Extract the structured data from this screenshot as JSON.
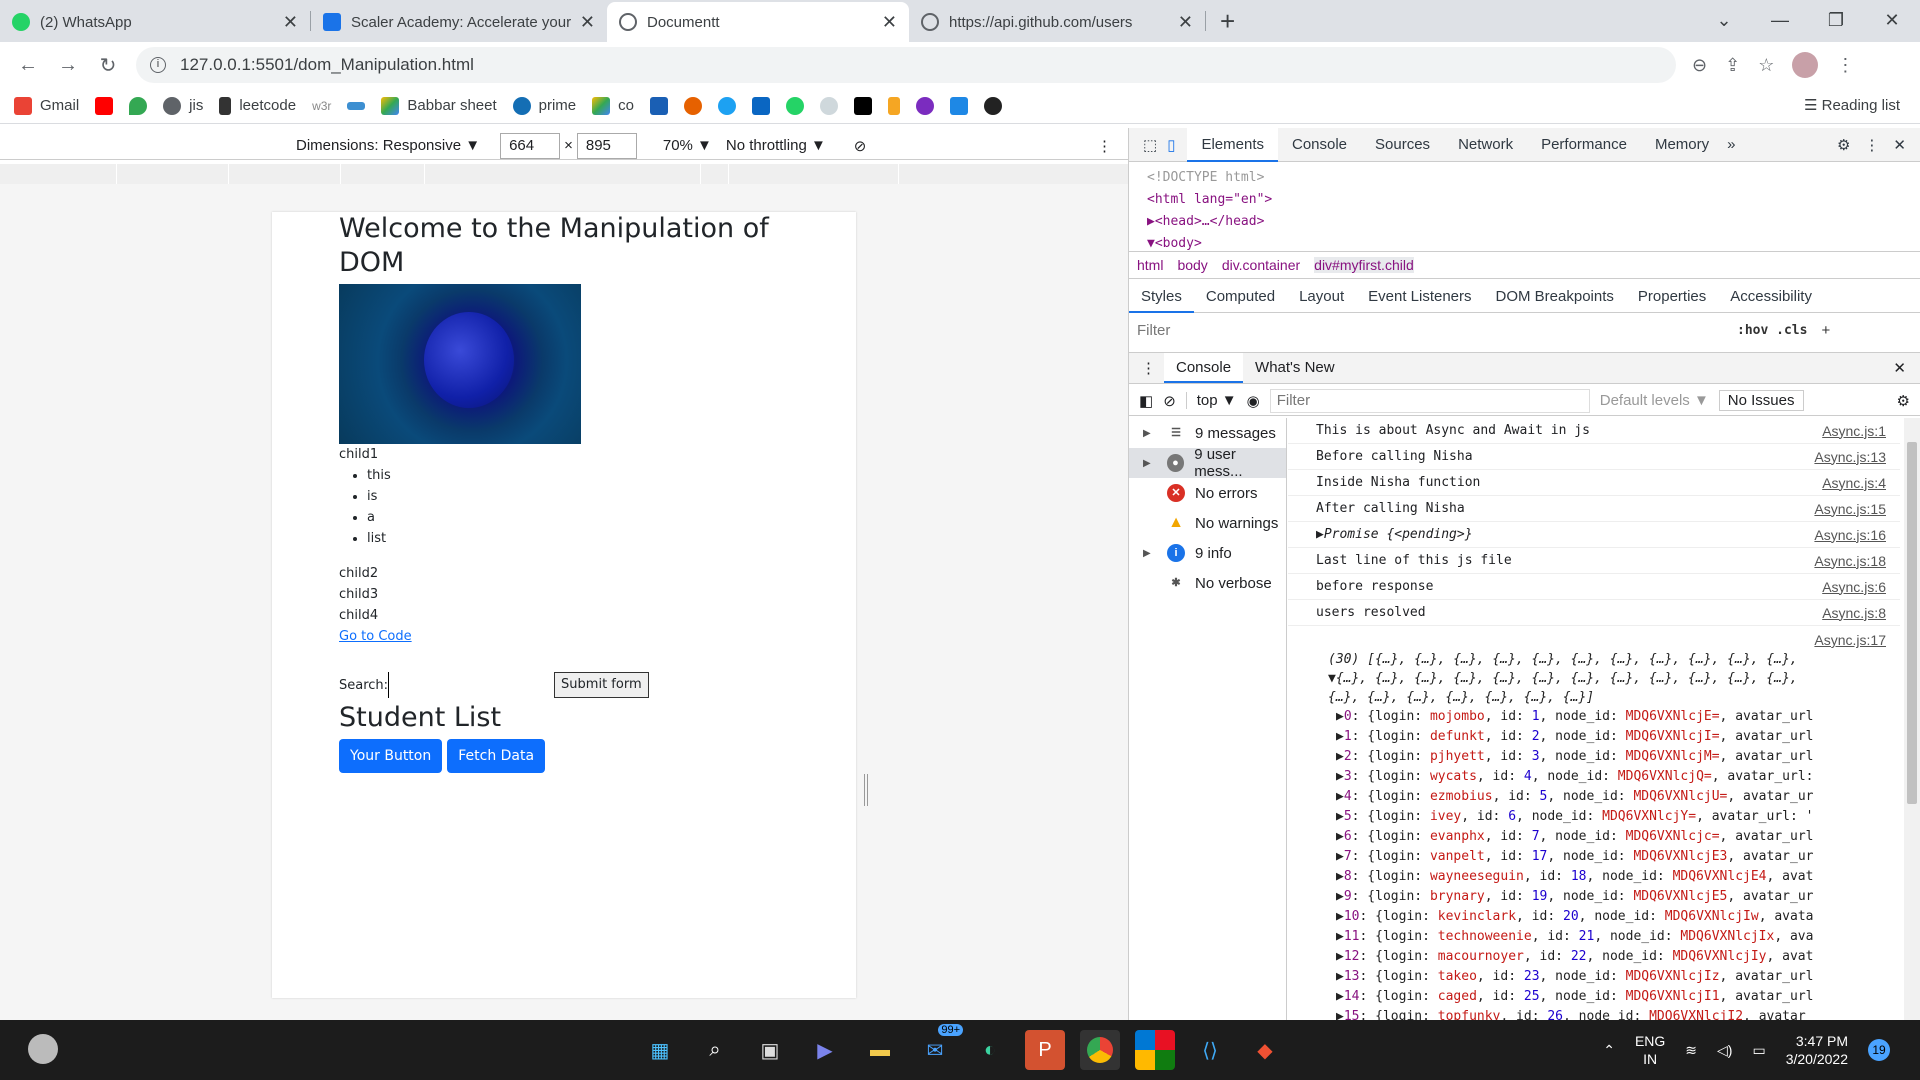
{
  "tabs": [
    {
      "title": "(2) WhatsApp",
      "color": "#25d366"
    },
    {
      "title": "Scaler Academy: Accelerate your",
      "color": "#1a73e8"
    },
    {
      "title": "Documentt",
      "color": "#5f6368"
    },
    {
      "title": "https://api.github.com/users",
      "color": "#5f6368"
    }
  ],
  "url": "127.0.0.1:5501/dom_Manipulation.html",
  "bookmarks": [
    "Gmail",
    "",
    "",
    "jis",
    "leetcode",
    "w3r",
    "",
    "Babbar sheet",
    "prime",
    "co"
  ],
  "reading_list": "Reading list",
  "device_toolbar": {
    "dimensions": "Dimensions: Responsive ▼",
    "width": "664",
    "times": "×",
    "height": "895",
    "zoom": "70% ▼",
    "throttle": "No throttling ▼"
  },
  "page": {
    "heading": "Welcome to the Manipulation of DOM",
    "child1": "child1",
    "list": [
      "this",
      "is",
      "a",
      "list"
    ],
    "child2": "child2",
    "child3": "child3",
    "child4": "child4",
    "link": "Go to Code",
    "search_label": "Search:",
    "submit": "Submit form",
    "student_list": "Student List",
    "btn1": "Your Button",
    "btn2": "Fetch Data"
  },
  "devtools": {
    "tabs": [
      "Elements",
      "Console",
      "Sources",
      "Network",
      "Performance",
      "Memory"
    ],
    "dom_lines": [
      "<!DOCTYPE html>",
      "<html lang=\"en\">",
      "▶<head>…</head>",
      "▼<body>"
    ],
    "crumbs": [
      "html",
      "body",
      "div.container",
      "div#myfirst.child"
    ],
    "subtabs": [
      "Styles",
      "Computed",
      "Layout",
      "Event Listeners",
      "DOM Breakpoints",
      "Properties",
      "Accessibility"
    ],
    "filter": "Filter",
    "hov": ":hov .cls",
    "drawer_tabs": [
      "Console",
      "What's New"
    ],
    "context": "top ▼",
    "cfilter": "Filter",
    "levels": "Default levels ▼",
    "issues": "No Issues",
    "sidebar": [
      "9 messages",
      "9 user mess...",
      "No errors",
      "No warnings",
      "9 info",
      "No verbose"
    ],
    "logs": [
      {
        "msg": "This is about Async and Await in js",
        "src": "Async.js:1"
      },
      {
        "msg": "Before calling Nisha",
        "src": "Async.js:13"
      },
      {
        "msg": "Inside Nisha function",
        "src": "Async.js:4"
      },
      {
        "msg": "After calling Nisha",
        "src": "Async.js:15"
      },
      {
        "msg": "▶Promise {<pending>}",
        "src": "Async.js:16"
      },
      {
        "msg": "Last line of this js file",
        "src": "Async.js:18"
      },
      {
        "msg": "before response",
        "src": "Async.js:6"
      },
      {
        "msg": "users resolved",
        "src": "Async.js:8"
      }
    ],
    "last_src": "Async.js:17",
    "array_lines": [
      "(30) [{…}, {…}, {…}, {…}, {…}, {…}, {…}, {…}, {…}, {…}, {…},",
      "▼{…}, {…}, {…}, {…}, {…}, {…}, {…}, {…}, {…}, {…}, {…}, {…},",
      "{…}, {…}, {…}, {…}, {…}, {…}, {…}]"
    ],
    "users": [
      {
        "i": "0",
        "login": "mojombo",
        "id": "1",
        "nid": "MDQ6VXNlcjE=",
        "tail": "avatar_url"
      },
      {
        "i": "1",
        "login": "defunkt",
        "id": "2",
        "nid": "MDQ6VXNlcjI=",
        "tail": "avatar_url"
      },
      {
        "i": "2",
        "login": "pjhyett",
        "id": "3",
        "nid": "MDQ6VXNlcjM=",
        "tail": "avatar_url"
      },
      {
        "i": "3",
        "login": "wycats",
        "id": "4",
        "nid": "MDQ6VXNlcjQ=",
        "tail": "avatar_url:"
      },
      {
        "i": "4",
        "login": "ezmobius",
        "id": "5",
        "nid": "MDQ6VXNlcjU=",
        "tail": "avatar_ur"
      },
      {
        "i": "5",
        "login": "ivey",
        "id": "6",
        "nid": "MDQ6VXNlcjY=",
        "tail": "avatar_url: '"
      },
      {
        "i": "6",
        "login": "evanphx",
        "id": "7",
        "nid": "MDQ6VXNlcjc=",
        "tail": "avatar_url"
      },
      {
        "i": "7",
        "login": "vanpelt",
        "id": "17",
        "nid": "MDQ6VXNlcjE3",
        "tail": "avatar_ur"
      },
      {
        "i": "8",
        "login": "wayneeseguin",
        "id": "18",
        "nid": "MDQ6VXNlcjE4",
        "tail": "avat"
      },
      {
        "i": "9",
        "login": "brynary",
        "id": "19",
        "nid": "MDQ6VXNlcjE5",
        "tail": "avatar_ur"
      },
      {
        "i": "10",
        "login": "kevinclark",
        "id": "20",
        "nid": "MDQ6VXNlcjIw",
        "tail": "avata"
      },
      {
        "i": "11",
        "login": "technoweenie",
        "id": "21",
        "nid": "MDQ6VXNlcjIx",
        "tail": "ava"
      },
      {
        "i": "12",
        "login": "macournoyer",
        "id": "22",
        "nid": "MDQ6VXNlcjIy",
        "tail": "avat"
      },
      {
        "i": "13",
        "login": "takeo",
        "id": "23",
        "nid": "MDQ6VXNlcjIz",
        "tail": "avatar_url"
      },
      {
        "i": "14",
        "login": "caged",
        "id": "25",
        "nid": "MDQ6VXNlcjI1",
        "tail": "avatar_url"
      },
      {
        "i": "15",
        "login": "topfunky",
        "id": "26",
        "nid": "MDQ6VXNlcjI2",
        "tail": "avatar"
      }
    ]
  },
  "taskbar": {
    "lang1": "ENG",
    "lang2": "IN",
    "time": "3:47 PM",
    "date": "3/20/2022",
    "badge": "99+",
    "notif": "19"
  }
}
